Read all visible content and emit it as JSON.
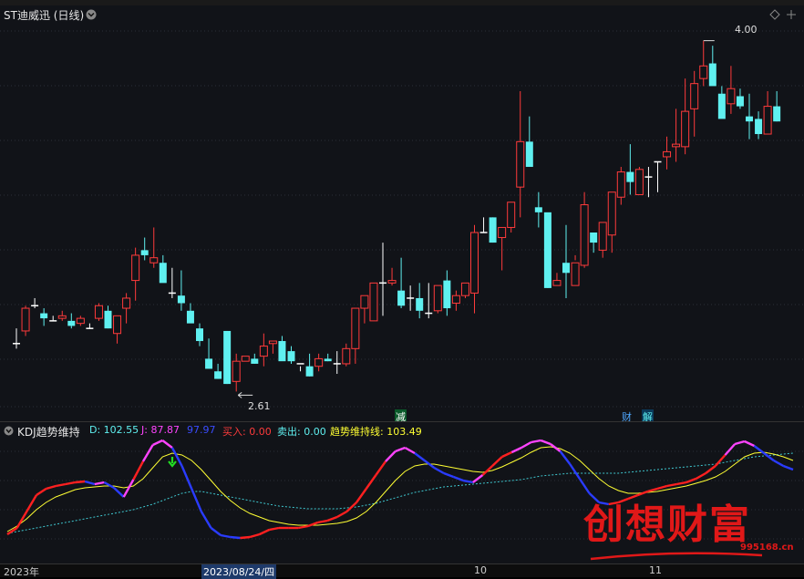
{
  "chart_title": "ST迪威迅 (日线)",
  "price_markers": {
    "high": "4.00",
    "low": "2.61"
  },
  "event_tags": [
    "减",
    "财",
    "解"
  ],
  "kdj": {
    "name": "KDJ趋势维持",
    "d_label": "D: 102.55",
    "j_label": "J: 87.87",
    "k_partial": "97.97",
    "buy": "买入: 0.00",
    "sell": "卖出: 0.00",
    "trend": "趋势维持线: 103.49"
  },
  "axis_labels": [
    "2023年",
    "2023/08/24/四",
    "10",
    "11"
  ],
  "watermark": {
    "text": "创想财富",
    "url": "995168.cn"
  },
  "colors": {
    "up": "#ff3b3b",
    "down": "#5ff0f0",
    "k_line": "#ff2020",
    "d_line": "#2a3cff",
    "yellow_line": "#ffff33",
    "dotted": "#3fc8d0"
  },
  "chart_data": {
    "type": "candlestick",
    "candles": [
      [
        2.8,
        2.86,
        2.78,
        2.8
      ],
      [
        2.85,
        2.95,
        2.83,
        2.94
      ],
      [
        2.95,
        2.98,
        2.94,
        2.95
      ],
      [
        2.92,
        2.94,
        2.87,
        2.9
      ],
      [
        2.89,
        2.91,
        2.89,
        2.89
      ],
      [
        2.9,
        2.93,
        2.89,
        2.91
      ],
      [
        2.89,
        2.92,
        2.86,
        2.87
      ],
      [
        2.88,
        2.91,
        2.87,
        2.9
      ],
      [
        2.86,
        2.88,
        2.86,
        2.86
      ],
      [
        2.9,
        2.96,
        2.89,
        2.95
      ],
      [
        2.93,
        2.95,
        2.86,
        2.86
      ],
      [
        2.84,
        2.91,
        2.8,
        2.91
      ],
      [
        2.94,
        3.0,
        2.88,
        2.98
      ],
      [
        3.05,
        3.18,
        2.97,
        3.15
      ],
      [
        3.17,
        3.22,
        3.13,
        3.15
      ],
      [
        3.12,
        3.26,
        3.1,
        3.14
      ],
      [
        3.12,
        3.15,
        3.07,
        3.04
      ],
      [
        3.0,
        3.1,
        2.98,
        3.0
      ],
      [
        2.99,
        3.09,
        2.93,
        2.96
      ],
      [
        2.93,
        2.96,
        2.89,
        2.88
      ],
      [
        2.86,
        2.88,
        2.79,
        2.81
      ],
      [
        2.74,
        2.82,
        2.7,
        2.7
      ],
      [
        2.69,
        2.72,
        2.66,
        2.66
      ],
      [
        2.85,
        2.85,
        2.64,
        2.64
      ],
      [
        2.65,
        2.76,
        2.61,
        2.73
      ],
      [
        2.73,
        2.75,
        2.73,
        2.75
      ],
      [
        2.74,
        2.76,
        2.72,
        2.72
      ],
      [
        2.75,
        2.84,
        2.71,
        2.79
      ],
      [
        2.8,
        2.81,
        2.76,
        2.81
      ],
      [
        2.81,
        2.83,
        2.75,
        2.73
      ],
      [
        2.77,
        2.79,
        2.72,
        2.73
      ],
      [
        2.72,
        2.71,
        2.69,
        2.72
      ],
      [
        2.71,
        2.76,
        2.67,
        2.67
      ],
      [
        2.71,
        2.76,
        2.69,
        2.74
      ],
      [
        2.74,
        2.76,
        2.73,
        2.73
      ],
      [
        2.72,
        2.77,
        2.68,
        2.72
      ],
      [
        2.72,
        2.8,
        2.71,
        2.78
      ],
      [
        2.78,
        2.94,
        2.72,
        2.94
      ],
      [
        2.94,
        2.99,
        2.88,
        2.99
      ],
      [
        2.89,
        3.0,
        2.91,
        3.04
      ],
      [
        3.04,
        3.2,
        2.91,
        3.04
      ],
      [
        3.04,
        3.1,
        3.03,
        3.05
      ],
      [
        3.01,
        3.14,
        2.94,
        2.95
      ],
      [
        2.98,
        3.03,
        2.93,
        2.98
      ],
      [
        2.98,
        3.04,
        2.9,
        2.93
      ],
      [
        2.92,
        3.04,
        2.9,
        2.92
      ],
      [
        2.93,
        3.0,
        2.92,
        3.03
      ],
      [
        3.05,
        3.09,
        2.91,
        2.94
      ],
      [
        2.96,
        3.01,
        2.93,
        2.99
      ],
      [
        2.99,
        3.04,
        2.98,
        3.04
      ],
      [
        3.0,
        3.27,
        2.92,
        3.24
      ],
      [
        3.24,
        3.3,
        3.24,
        3.24
      ],
      [
        3.3,
        3.3,
        3.2,
        3.2
      ],
      [
        3.22,
        3.23,
        3.09,
        3.26
      ],
      [
        3.26,
        3.32,
        3.24,
        3.36
      ],
      [
        3.42,
        3.8,
        3.3,
        3.6
      ],
      [
        3.6,
        3.7,
        3.5,
        3.5
      ],
      [
        3.34,
        3.4,
        3.26,
        3.32
      ],
      [
        3.32,
        3.3,
        3.02,
        3.02
      ],
      [
        3.03,
        3.08,
        3.03,
        3.05
      ],
      [
        3.12,
        3.27,
        2.98,
        3.08
      ],
      [
        3.03,
        3.15,
        3.13,
        3.12
      ],
      [
        3.11,
        3.4,
        3.1,
        3.35
      ],
      [
        3.24,
        3.2,
        3.16,
        3.2
      ],
      [
        3.17,
        3.28,
        3.14,
        3.28
      ],
      [
        3.23,
        3.35,
        3.16,
        3.4
      ],
      [
        3.38,
        3.5,
        3.35,
        3.48
      ],
      [
        3.48,
        3.59,
        3.39,
        3.44
      ],
      [
        3.39,
        3.5,
        3.4,
        3.49
      ],
      [
        3.46,
        3.5,
        3.38,
        3.46
      ],
      [
        3.52,
        3.52,
        3.4,
        3.52
      ],
      [
        3.54,
        3.62,
        3.49,
        3.56
      ],
      [
        3.58,
        3.73,
        3.52,
        3.59
      ],
      [
        3.58,
        3.85,
        3.55,
        3.72
      ],
      [
        3.73,
        3.88,
        3.62,
        3.83
      ],
      [
        3.85,
        4.0,
        3.82,
        3.9
      ],
      [
        3.91,
        3.98,
        3.83,
        3.82
      ],
      [
        3.79,
        3.82,
        3.71,
        3.69
      ],
      [
        3.75,
        3.9,
        3.71,
        3.81
      ],
      [
        3.78,
        3.81,
        3.73,
        3.74
      ],
      [
        3.7,
        3.79,
        3.61,
        3.68
      ],
      [
        3.69,
        3.72,
        3.61,
        3.63
      ],
      [
        3.63,
        3.8,
        3.65,
        3.74
      ],
      [
        3.74,
        3.8,
        3.68,
        3.68
      ]
    ]
  }
}
